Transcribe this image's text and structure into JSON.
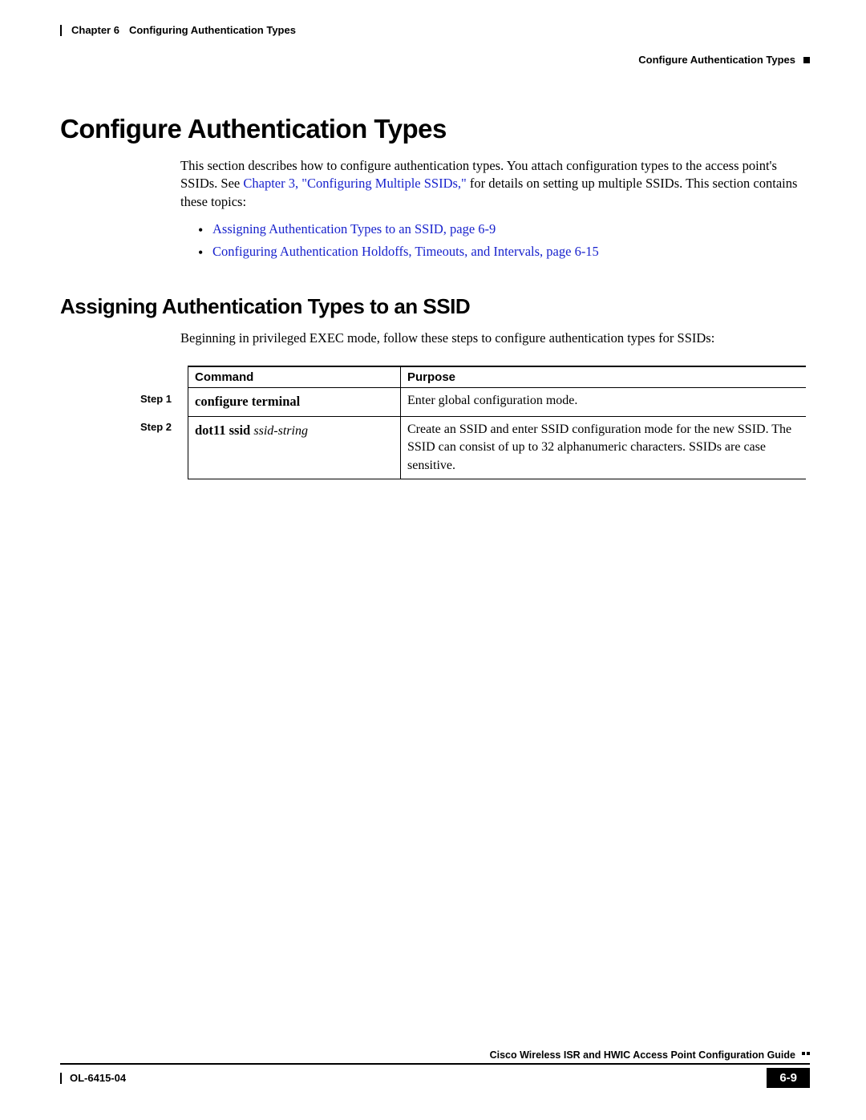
{
  "header": {
    "chapter_label": "Chapter 6",
    "chapter_title": "Configuring Authentication Types",
    "section_title": "Configure Authentication Types"
  },
  "h1": "Configure Authentication Types",
  "intro": {
    "part1": "This section describes how to configure authentication types. You attach configuration types to the access point's SSIDs. See ",
    "link1": "Chapter 3, \"Configuring Multiple SSIDs,\"",
    "part2": " for details on setting up multiple SSIDs. This section contains these topics:"
  },
  "topics": [
    "Assigning Authentication Types to an SSID, page 6-9",
    "Configuring Authentication Holdoffs, Timeouts, and Intervals, page 6-15"
  ],
  "h2": "Assigning Authentication Types to an SSID",
  "sub_intro": "Beginning in privileged EXEC mode, follow these steps to configure authentication types for SSIDs:",
  "table": {
    "headers": {
      "command": "Command",
      "purpose": "Purpose"
    },
    "rows": [
      {
        "step": "Step 1",
        "command_bold": "configure terminal",
        "command_italic": "",
        "purpose": "Enter global configuration mode."
      },
      {
        "step": "Step 2",
        "command_bold": "dot11 ssid ",
        "command_italic": "ssid-string",
        "purpose": "Create an SSID and enter SSID configuration mode for the new SSID. The SSID can consist of up to 32 alphanumeric characters. SSIDs are case sensitive."
      }
    ]
  },
  "footer": {
    "guide": "Cisco Wireless ISR and HWIC Access Point Configuration Guide",
    "doc_id": "OL-6415-04",
    "page": "6-9"
  }
}
